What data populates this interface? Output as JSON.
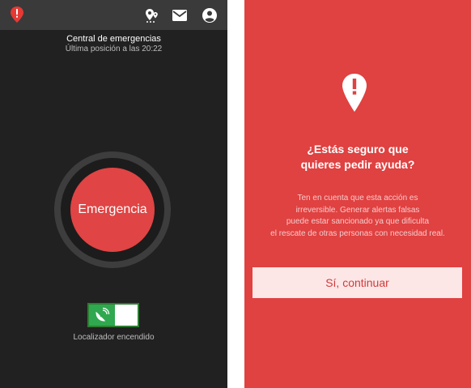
{
  "colors": {
    "dark_bg": "#212121",
    "topbar_bg": "#3a3a3a",
    "accent_red": "#e04444",
    "toggle_green": "#2fa84f",
    "dialog_red": "#e04141",
    "button_pale": "#fde6e6"
  },
  "left": {
    "topbar": {
      "logo_icon": "alert-pin-icon",
      "actions": [
        {
          "icon": "map-pin-icon"
        },
        {
          "icon": "mail-icon"
        },
        {
          "icon": "account-icon"
        }
      ]
    },
    "header": {
      "title": "Central de emergencias",
      "subtitle": "Última posición a las 20:22"
    },
    "emergency_button": {
      "label": "Emergencia"
    },
    "locator": {
      "state": "on",
      "icon": "satellite-dish-icon",
      "label": "Localizador encendido"
    }
  },
  "right": {
    "icon": "alert-pin-icon",
    "question_line1": "¿Estás seguro que",
    "question_line2": "quieres pedir ayuda?",
    "notice_lines": [
      "Ten en cuenta que esta acción es",
      "irreversible. Generar alertas falsas",
      "puede estar sancionado ya que dificulta",
      "el rescate de otras personas con necesidad real."
    ],
    "confirm_label": "Sí, continuar"
  }
}
